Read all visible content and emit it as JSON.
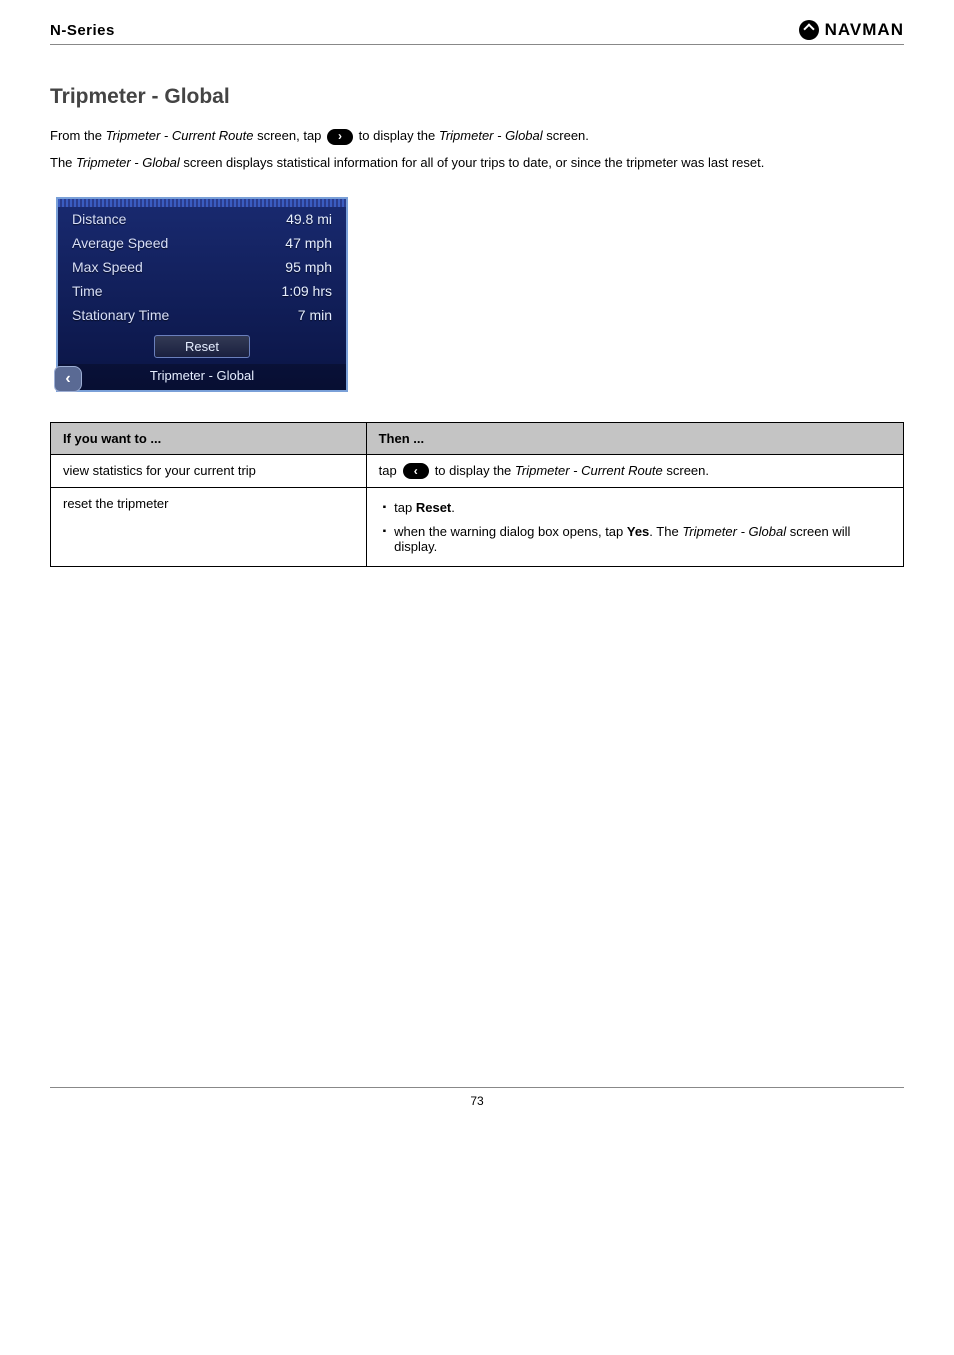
{
  "header": {
    "left": "N-Series",
    "brand": "NAVMAN"
  },
  "section_title": "Tripmeter - Global",
  "paragraph1_a": "From the ",
  "paragraph1_b": "Tripmeter - Current Route",
  "paragraph1_c": " screen, tap ",
  "paragraph1_d": " to display the ",
  "paragraph1_e": "Tripmeter - Global",
  "paragraph1_f": " screen.",
  "paragraph2_a": "The ",
  "paragraph2_b": "Tripmeter - Global",
  "paragraph2_c": " screen displays statistical information for all of your trips to date, or since the tripmeter was last reset.",
  "device": {
    "rows": [
      {
        "label": "Distance",
        "value": "49.8 mi"
      },
      {
        "label": "Average Speed",
        "value": "47 mph"
      },
      {
        "label": "Max Speed",
        "value": "95 mph"
      },
      {
        "label": "Time",
        "value": "1:09 hrs"
      },
      {
        "label": "Stationary Time",
        "value": "7 min"
      }
    ],
    "reset_label": "Reset",
    "bottom_title": "Tripmeter - Global"
  },
  "table": {
    "head_left": "If you want to ...",
    "head_right": "Then ...",
    "row1_left": "view statistics for your current trip",
    "row1_right_a": "tap ",
    "row1_right_b": " to display the ",
    "row1_right_c": "Tripmeter - Current Route",
    "row1_right_d": " screen.",
    "row2_left": "reset the tripmeter",
    "row2_b1_a": "tap ",
    "row2_b1_b": "Reset",
    "row2_b1_c": ".",
    "row2_b2_a": "when the warning dialog box opens, tap ",
    "row2_b2_b": "Yes",
    "row2_b2_c": ". The ",
    "row2_b2_d": "Tripmeter - Global",
    "row2_b2_e": " screen will display."
  },
  "page_number": "73"
}
